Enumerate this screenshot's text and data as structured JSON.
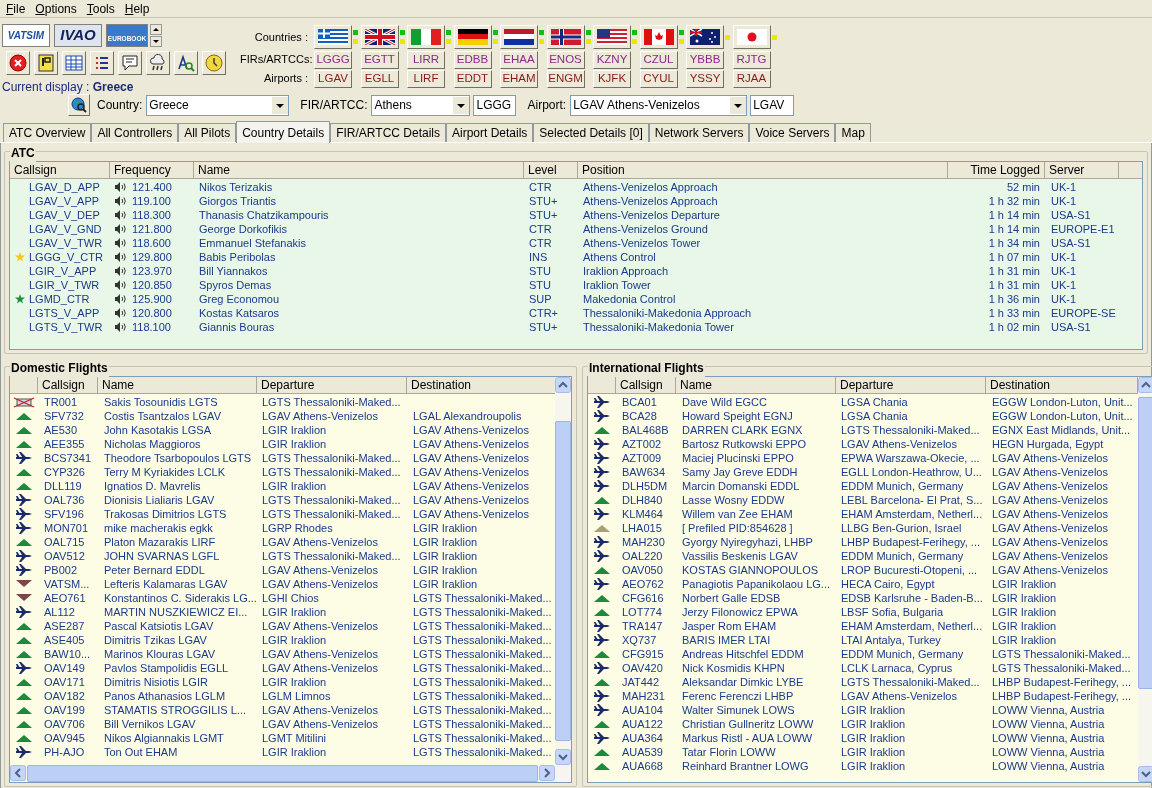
{
  "menu": [
    "File",
    "Options",
    "Tools",
    "Help"
  ],
  "logos": [
    {
      "label": "VATSIM",
      "kind": "plain"
    },
    {
      "label": "IVAO",
      "kind": "bold"
    },
    {
      "label": "EUROBOOK",
      "kind": "banner"
    }
  ],
  "countries_label": "Countries :",
  "firs_label": "FIRs/ARTCCs:",
  "airports_label": "Airports :",
  "countries": [
    {
      "fir": "LGGG",
      "airport": "LGAV",
      "indicators": [
        {
          "color": "#10c010"
        },
        {
          "color": "#e8e800"
        }
      ]
    },
    {
      "fir": "EGTT",
      "airport": "EGLL",
      "indicators": [
        {
          "color": "#10c010"
        },
        {
          "color": "#e8e800"
        }
      ]
    },
    {
      "fir": "LIRR",
      "airport": "LIRF",
      "indicators": [
        {
          "color": "#10c010"
        },
        {
          "color": "#e8e800"
        }
      ]
    },
    {
      "fir": "EDBB",
      "airport": "EDDT",
      "indicators": [
        {
          "color": "#10c010"
        },
        {
          "color": "#e8e800"
        }
      ]
    },
    {
      "fir": "EHAA",
      "airport": "EHAM",
      "indicators": [
        {
          "color": "#10c010"
        },
        {
          "color": "#e8e800"
        }
      ]
    },
    {
      "fir": "ENOS",
      "airport": "ENGM",
      "indicators": [
        {
          "color": "#10c010"
        },
        {
          "color": "#e8e800"
        }
      ]
    },
    {
      "fir": "KZNY",
      "airport": "KJFK",
      "indicators": [
        {
          "color": "#10c010"
        },
        {
          "color": "#e8e800"
        }
      ]
    },
    {
      "fir": "CZUL",
      "airport": "CYUL",
      "indicators": [
        {
          "color": "#10c010"
        },
        {
          "color": "#e8e800"
        }
      ]
    },
    {
      "fir": "YBBB",
      "airport": "YSSY",
      "indicators": [
        {
          "color": "#e8e800"
        }
      ]
    },
    {
      "fir": "RJTG",
      "airport": "RJAA",
      "indicators": [
        {
          "color": "#e8e800"
        }
      ]
    }
  ],
  "current_display": "Current display : **Greece**",
  "filters": {
    "country_label": "Country:",
    "country": "Greece",
    "fir_label": "FIR/ARTCC:",
    "fir": "Athens",
    "fir_code": "LGGG",
    "airport_label": "Airport:",
    "airport": "LGAV Athens-Venizelos",
    "airport_code": "LGAV"
  },
  "tabs": [
    {
      "label": "ATC Overview",
      "selected": false
    },
    {
      "label": "All Controllers",
      "selected": false
    },
    {
      "label": "All Pilots",
      "selected": false
    },
    {
      "label": "Country Details",
      "selected": true
    },
    {
      "label": "FIR/ARTCC Details",
      "selected": false
    },
    {
      "label": "Airport Details",
      "selected": false
    },
    {
      "label": "Selected Details [0]",
      "selected": false
    },
    {
      "label": "Network Servers",
      "selected": false
    },
    {
      "label": "Voice Servers",
      "selected": false
    },
    {
      "label": "Map",
      "selected": false
    }
  ],
  "atc": {
    "title": "ATC",
    "columns": [
      "Callsign",
      "Frequency",
      "Name",
      "Level",
      "Position",
      "Time Logged",
      "Server"
    ],
    "rows": [
      {
        "callsign": "LGAV_D_APP",
        "frequency": "121.400",
        "name": "Nikos Terizakis",
        "level": "CTR",
        "position": "Athens-Venizelos Approach",
        "time": "52 min",
        "server": "UK-1",
        "star": false
      },
      {
        "callsign": "LGAV_V_APP",
        "frequency": "119.100",
        "name": "Giorgos Triantis",
        "level": "STU+",
        "position": "Athens-Venizelos Approach",
        "time": "1 h 32 min",
        "server": "UK-1",
        "star": false
      },
      {
        "callsign": "LGAV_V_DEP",
        "frequency": "118.300",
        "name": "Thanasis Chatzikampouris",
        "level": "STU+",
        "position": "Athens-Venizelos Departure",
        "time": "1 h 14 min",
        "server": "USA-S1",
        "star": false
      },
      {
        "callsign": "LGAV_V_GND",
        "frequency": "121.800",
        "name": "George Dorkofikis",
        "level": "CTR",
        "position": "Athens-Venizelos Ground",
        "time": "1 h 14 min",
        "server": "EUROPE-E1",
        "star": false
      },
      {
        "callsign": "LGAV_V_TWR",
        "frequency": "118.600",
        "name": "Emmanuel Stefanakis",
        "level": "CTR",
        "position": "Athens-Venizelos Tower",
        "time": "1 h 34 min",
        "server": "USA-S1",
        "star": false
      },
      {
        "callsign": "LGGG_V_CTR",
        "frequency": "129.800",
        "name": "Babis Peribolas",
        "level": "INS",
        "position": "Athens Control",
        "time": "1 h 07 min",
        "server": "UK-1",
        "star": true,
        "color": "#f5c518"
      },
      {
        "callsign": "LGIR_V_APP",
        "frequency": "123.970",
        "name": "Bill Yiannakos",
        "level": "STU",
        "position": "Iraklion Approach",
        "time": "1 h 31 min",
        "server": "UK-1",
        "star": false
      },
      {
        "callsign": "LGIR_V_TWR",
        "frequency": "120.850",
        "name": "Spyros Demas",
        "level": "STU",
        "position": "Iraklion Tower",
        "time": "1 h 31 min",
        "server": "UK-1",
        "star": false
      },
      {
        "callsign": "LGMD_CTR",
        "frequency": "125.900",
        "name": "Greg Economou",
        "level": "SUP",
        "position": "Makedonia Control",
        "time": "1 h 36 min",
        "server": "UK-1",
        "star": true,
        "color": "#209040"
      },
      {
        "callsign": "LGTS_V_APP",
        "frequency": "120.800",
        "name": "Kostas Katsaros",
        "level": "CTR+",
        "position": "Thessaloniki-Makedonia Approach",
        "time": "1 h 33 min",
        "server": "EUROPE-SE",
        "star": false
      },
      {
        "callsign": "LGTS_V_TWR",
        "frequency": "118.100",
        "name": "Giannis Bouras",
        "level": "STU+",
        "position": "Thessaloniki-Makedonia Tower",
        "time": "1 h 02 min",
        "server": "USA-S1",
        "star": false
      }
    ]
  },
  "domestic": {
    "title": "Domestic Flights",
    "columns": [
      "Callsign",
      "Name",
      "Departure",
      "Destination"
    ],
    "rows": [
      {
        "kind": "ground",
        "callsign": "TR001",
        "name": "Sakis Tosounidis LGTS",
        "departure": "LGTS Thessaloniki-Maked..."
      },
      {
        "kind": "climb",
        "callsign": "SFV732",
        "name": "Costis Tsantzalos LGAV",
        "departure": "LGAV Athens-Venizelos",
        "destination": "LGAL Alexandroupolis"
      },
      {
        "kind": "climb",
        "callsign": "AE530",
        "name": "John Kasotakis LGSA",
        "departure": "LGIR Iraklion",
        "destination": "LGAV Athens-Venizelos"
      },
      {
        "kind": "climb",
        "callsign": "AEE355",
        "name": "Nicholas Maggioros",
        "departure": "LGIR Iraklion",
        "destination": "LGAV Athens-Venizelos"
      },
      {
        "kind": "cruise",
        "callsign": "BCS7341",
        "name": "Theodore Tsarbopoulos LGTS",
        "departure": "LGTS Thessaloniki-Maked...",
        "destination": "LGAV Athens-Venizelos"
      },
      {
        "kind": "climb",
        "callsign": "CYP326",
        "name": "Terry M Kyriakides LCLK",
        "departure": "LGTS Thessaloniki-Maked...",
        "destination": "LGAV Athens-Venizelos"
      },
      {
        "kind": "climb",
        "callsign": "DLL119",
        "name": "Ignatios D. Mavrelis",
        "departure": "LGIR Iraklion",
        "destination": "LGAV Athens-Venizelos"
      },
      {
        "kind": "cruise",
        "callsign": "OAL736",
        "name": "Dionisis Lialiaris LGAV",
        "departure": "LGTS Thessaloniki-Maked...",
        "destination": "LGAV Athens-Venizelos"
      },
      {
        "kind": "cruise",
        "callsign": "SFV196",
        "name": "Trakosas Dimitrios LGTS",
        "departure": "LGTS Thessaloniki-Maked...",
        "destination": "LGAV Athens-Venizelos"
      },
      {
        "kind": "cruise",
        "callsign": "MON701",
        "name": "mike macherakis egkk",
        "departure": "LGRP Rhodes",
        "destination": "LGIR Iraklion"
      },
      {
        "kind": "climb",
        "callsign": "OAL715",
        "name": "Platon Mazarakis LIRF",
        "departure": "LGAV Athens-Venizelos",
        "destination": "LGIR Iraklion"
      },
      {
        "kind": "cruise",
        "callsign": "OAV512",
        "name": "JOHN SVARNAS LGFL",
        "departure": "LGTS Thessaloniki-Maked...",
        "destination": "LGIR Iraklion"
      },
      {
        "kind": "cruise",
        "callsign": "PB002",
        "name": "Peter Bernard EDDL",
        "departure": "LGAV Athens-Venizelos",
        "destination": "LGIR Iraklion"
      },
      {
        "kind": "descend",
        "callsign": "VATSM...",
        "name": "Lefteris Kalamaras LGAV",
        "departure": "LGAV Athens-Venizelos",
        "destination": "LGIR Iraklion"
      },
      {
        "kind": "descend",
        "callsign": "AEO761",
        "name": "Konstantinos C. Siderakis LG...",
        "departure": "LGHI Chios",
        "destination": "LGTS Thessaloniki-Maked..."
      },
      {
        "kind": "cruise",
        "callsign": "AL112",
        "name": "MARTIN NUSZKIEWICZ EI...",
        "departure": "LGIR Iraklion",
        "destination": "LGTS Thessaloniki-Maked..."
      },
      {
        "kind": "climb",
        "callsign": "ASE287",
        "name": "Pascal Katsiotis LGAV",
        "departure": "LGAV Athens-Venizelos",
        "destination": "LGTS Thessaloniki-Maked..."
      },
      {
        "kind": "climb",
        "callsign": "ASE405",
        "name": "Dimitris Tzikas LGAV",
        "departure": "LGIR Iraklion",
        "destination": "LGTS Thessaloniki-Maked..."
      },
      {
        "kind": "climb",
        "callsign": "BAW10...",
        "name": "Marinos Klouras LGAV",
        "departure": "LGAV Athens-Venizelos",
        "destination": "LGTS Thessaloniki-Maked..."
      },
      {
        "kind": "cruise",
        "callsign": "OAV149",
        "name": "Pavlos Stampolidis EGLL",
        "departure": "LGAV Athens-Venizelos",
        "destination": "LGTS Thessaloniki-Maked..."
      },
      {
        "kind": "climb",
        "callsign": "OAV171",
        "name": "Dimitris Nisiotis LGIR",
        "departure": "LGIR Iraklion",
        "destination": "LGTS Thessaloniki-Maked..."
      },
      {
        "kind": "climb",
        "callsign": "OAV182",
        "name": "Panos Athanasios LGLM",
        "departure": "LGLM Limnos",
        "destination": "LGTS Thessaloniki-Maked..."
      },
      {
        "kind": "climb",
        "callsign": "OAV199",
        "name": "STAMATIS STROGGILIS L...",
        "departure": "LGAV Athens-Venizelos",
        "destination": "LGTS Thessaloniki-Maked..."
      },
      {
        "kind": "climb",
        "callsign": "OAV706",
        "name": "Bill Vernikos LGAV",
        "departure": "LGAV Athens-Venizelos",
        "destination": "LGTS Thessaloniki-Maked..."
      },
      {
        "kind": "climb",
        "callsign": "OAV945",
        "name": "Nikos Algiannakis LGMT",
        "departure": "LGMT Mitilini",
        "destination": "LGTS Thessaloniki-Maked..."
      },
      {
        "kind": "cruise",
        "callsign": "PH-AJO",
        "name": "Ton Out EHAM",
        "departure": "LGIR Iraklion",
        "destination": "LGTS Thessaloniki-Maked..."
      }
    ]
  },
  "international": {
    "title": "International Flights",
    "columns": [
      "Callsign",
      "Name",
      "Departure",
      "Destination"
    ],
    "rows": [
      {
        "kind": "cruise",
        "callsign": "BCA01",
        "name": "Dave Wild EGCC",
        "departure": "LGSA Chania",
        "destination": "EGGW London-Luton, Unit..."
      },
      {
        "kind": "cruise",
        "callsign": "BCA28",
        "name": "Howard Speight EGNJ",
        "departure": "LGSA Chania",
        "destination": "EGGW London-Luton, Unit..."
      },
      {
        "kind": "climb",
        "callsign": "BAL468B",
        "name": "DARREN CLARK EGNX",
        "departure": "LGTS Thessaloniki-Maked...",
        "destination": "EGNX East Midlands, Unit..."
      },
      {
        "kind": "cruise",
        "callsign": "AZT002",
        "name": "Bartosz Rutkowski EPPO",
        "departure": "LGAV Athens-Venizelos",
        "destination": "HEGN Hurgada, Egypt"
      },
      {
        "kind": "cruise",
        "callsign": "AZT009",
        "name": "Maciej Plucinski EPPO",
        "departure": "EPWA Warszawa-Okecie, ...",
        "destination": "LGAV Athens-Venizelos"
      },
      {
        "kind": "cruise",
        "callsign": "BAW634",
        "name": "Samy Jay Greve EDDH",
        "departure": "EGLL London-Heathrow, U...",
        "destination": "LGAV Athens-Venizelos"
      },
      {
        "kind": "cruise",
        "callsign": "DLH5DM",
        "name": "Marcin Domanski EDDL",
        "departure": "EDDM Munich, Germany",
        "destination": "LGAV Athens-Venizelos"
      },
      {
        "kind": "climb",
        "callsign": "DLH840",
        "name": "Lasse Wosny EDDW",
        "departure": "LEBL Barcelona- El Prat, S...",
        "destination": "LGAV Athens-Venizelos"
      },
      {
        "kind": "cruise",
        "callsign": "KLM464",
        "name": "Willem van Zee EHAM",
        "departure": "EHAM Amsterdam, Netherl...",
        "destination": "LGAV Athens-Venizelos"
      },
      {
        "kind": "prefiled",
        "callsign": "LHA015",
        "name": "[ Prefiled PID:854628 ]",
        "departure": "LLBG Ben-Gurion, Israel",
        "destination": "LGAV Athens-Venizelos"
      },
      {
        "kind": "cruise",
        "callsign": "MAH230",
        "name": "Gyorgy Nyiregyhazi, LHBP",
        "departure": "LHBP Budapest-Ferihegy, ...",
        "destination": "LGAV Athens-Venizelos"
      },
      {
        "kind": "cruise",
        "callsign": "OAL220",
        "name": "Vassilis Beskenis LGAV",
        "departure": "EDDM Munich, Germany",
        "destination": "LGAV Athens-Venizelos"
      },
      {
        "kind": "climb",
        "callsign": "OAV050",
        "name": "KOSTAS GIANNOPOULOS",
        "departure": "LROP Bucuresti-Otopeni, ...",
        "destination": "LGAV Athens-Venizelos"
      },
      {
        "kind": "cruise",
        "callsign": "AEO762",
        "name": "Panagiotis Papanikolaou LG...",
        "departure": "HECA Cairo, Egypt",
        "destination": "LGIR Iraklion"
      },
      {
        "kind": "climb",
        "callsign": "CFG616",
        "name": "Norbert Galle EDSB",
        "departure": "EDSB Karlsruhe - Baden-B...",
        "destination": "LGIR Iraklion"
      },
      {
        "kind": "climb",
        "callsign": "LOT774",
        "name": "Jerzy Filonowicz EPWA",
        "departure": "LBSF Sofia, Bulgaria",
        "destination": "LGIR Iraklion"
      },
      {
        "kind": "cruise",
        "callsign": "TRA147",
        "name": "Jasper Rom EHAM",
        "departure": "EHAM Amsterdam, Netherl...",
        "destination": "LGIR Iraklion"
      },
      {
        "kind": "cruise",
        "callsign": "XQ737",
        "name": "BARIS IMER LTAI",
        "departure": "LTAI Antalya, Turkey",
        "destination": "LGIR Iraklion"
      },
      {
        "kind": "climb",
        "callsign": "CFG915",
        "name": "Andreas Hitschfel EDDM",
        "departure": "EDDM Munich, Germany",
        "destination": "LGTS Thessaloniki-Maked..."
      },
      {
        "kind": "cruise",
        "callsign": "OAV420",
        "name": "Nick Kosmidis KHPN",
        "departure": "LCLK Larnaca, Cyprus",
        "destination": "LGTS Thessaloniki-Maked..."
      },
      {
        "kind": "climb",
        "callsign": "JAT442",
        "name": "Aleksandar Dimkic LYBE",
        "departure": "LGTS Thessaloniki-Maked...",
        "destination": "LHBP Budapest-Ferihegy, ..."
      },
      {
        "kind": "cruise",
        "callsign": "MAH231",
        "name": "Ferenc Ferenczi LHBP",
        "departure": "LGAV Athens-Venizelos",
        "destination": "LHBP Budapest-Ferihegy, ..."
      },
      {
        "kind": "cruise",
        "callsign": "AUA104",
        "name": "Walter Simunek LOWS",
        "departure": "LGIR Iraklion",
        "destination": "LOWW Vienna, Austria"
      },
      {
        "kind": "climb",
        "callsign": "AUA122",
        "name": "Christian Gullneritz LOWW",
        "departure": "LGIR Iraklion",
        "destination": "LOWW Vienna, Austria"
      },
      {
        "kind": "cruise",
        "callsign": "AUA364",
        "name": "Markus Ristl - AUA LOWW",
        "departure": "LGIR Iraklion",
        "destination": "LOWW Vienna, Austria"
      },
      {
        "kind": "climb",
        "callsign": "AUA539",
        "name": "Tatar Florin LOWW",
        "departure": "LGIR Iraklion",
        "destination": "LOWW Vienna, Austria"
      },
      {
        "kind": "climb",
        "callsign": "AUA668",
        "name": "Reinhard Brantner LOWG",
        "departure": "LGIR Iraklion",
        "destination": "LOWW Vienna, Austria"
      }
    ]
  }
}
